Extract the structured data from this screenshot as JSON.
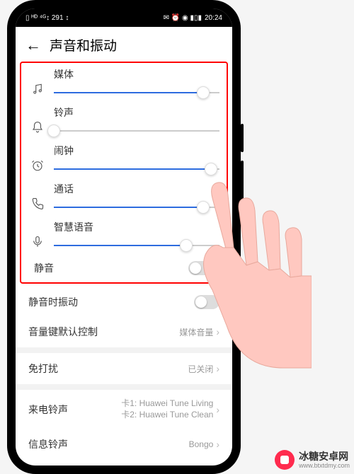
{
  "status_bar": {
    "left_icons": "▯ ᴴᴰ ⁴ᴳ↕ 291 ↕",
    "right_icons": "✉ ⏰ ◉ ▮▯▮",
    "time": "20:24"
  },
  "header": {
    "title": "声音和振动"
  },
  "sliders": [
    {
      "label": "媒体",
      "value": 90,
      "icon": "music"
    },
    {
      "label": "铃声",
      "value": 0,
      "icon": "bell"
    },
    {
      "label": "闹钟",
      "value": 95,
      "icon": "clock"
    },
    {
      "label": "通话",
      "value": 90,
      "icon": "phone"
    },
    {
      "label": "智慧语音",
      "value": 80,
      "icon": "mic"
    }
  ],
  "mute": {
    "label": "静音",
    "enabled": false
  },
  "settings": [
    {
      "key": "vibrate_on_mute",
      "label": "静音时振动",
      "type": "toggle",
      "enabled": false
    },
    {
      "key": "volume_key",
      "label": "音量键默认控制",
      "type": "value",
      "value": "媒体音量"
    },
    {
      "key": "dnd",
      "label": "免打扰",
      "type": "value",
      "value": "已关闭"
    },
    {
      "key": "ringtone",
      "label": "来电铃声",
      "type": "stack",
      "lines": [
        "卡1: Huawei Tune Living",
        "卡2: Huawei Tune Clean"
      ]
    },
    {
      "key": "sms_tone",
      "label": "信息铃声",
      "type": "value",
      "value": "Bongo"
    }
  ],
  "watermark": {
    "name": "冰糖安卓网",
    "url": "www.btxtdmy.com"
  }
}
